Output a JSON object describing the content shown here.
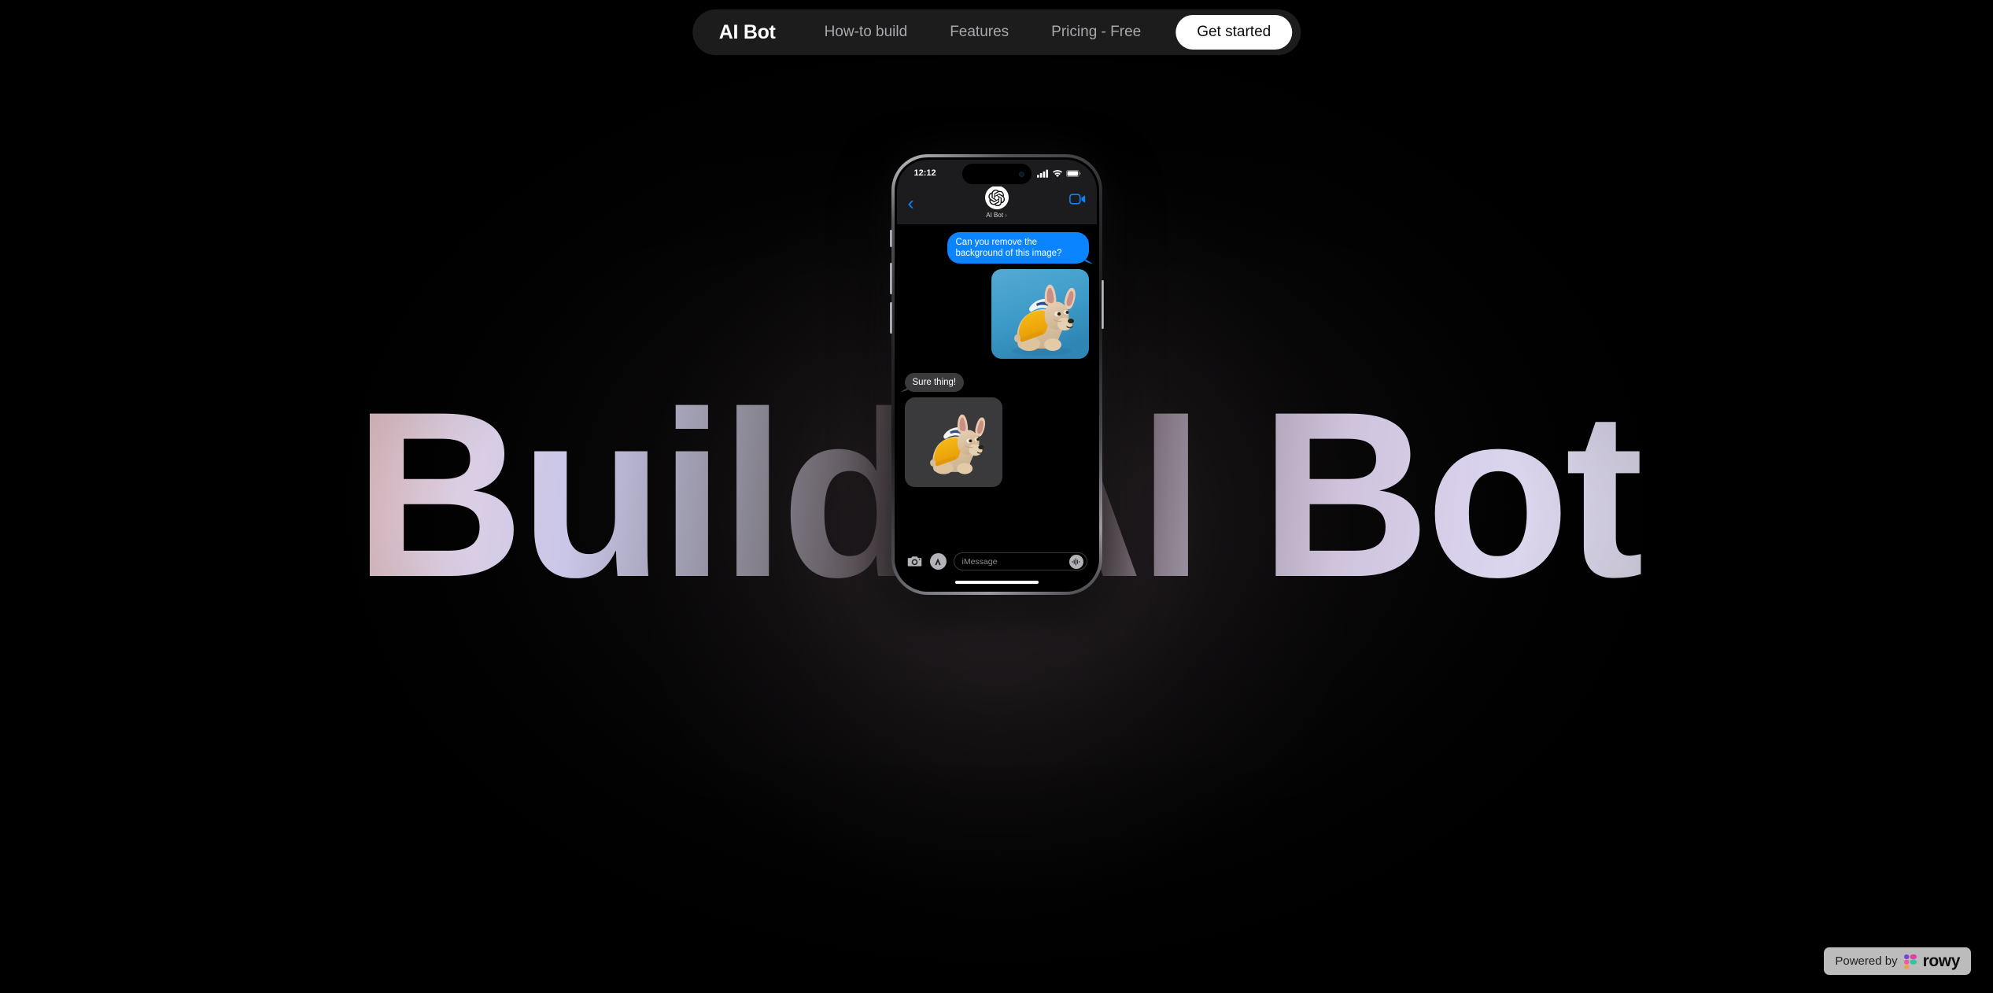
{
  "nav": {
    "brand": "AI Bot",
    "links": [
      {
        "label": "How-to build"
      },
      {
        "label": "Features"
      },
      {
        "label": "Pricing - Free"
      }
    ],
    "cta_label": "Get started"
  },
  "hero": {
    "headline": "Build AI Bot",
    "gradient_start": "#f6c4b7",
    "gradient_mid": "#c9c6e8",
    "gradient_end": "#eceaf6",
    "background_color": "#000000"
  },
  "phone": {
    "status_bar": {
      "time": "12:12",
      "cellular_icon": "cellular-bars-icon",
      "wifi_icon": "wifi-icon",
      "battery_icon": "battery-icon"
    },
    "chat_header": {
      "back_icon": "chevron-left-icon",
      "avatar_icon": "openai-logo-icon",
      "contact_name": "AI Bot",
      "disclosure_chevron": "›",
      "video_icon": "video-camera-icon"
    },
    "messages": [
      {
        "side": "outgoing",
        "type": "text",
        "text": "Can you remove the background of this image?",
        "bubble_color": "#0b84ff"
      },
      {
        "side": "outgoing",
        "type": "image",
        "alt": "French bulldog in yellow hoodie on blue background",
        "background_color": "#3d9bc9"
      },
      {
        "side": "incoming",
        "type": "text",
        "text": "Sure thing!",
        "bubble_color": "#3a3a3c"
      },
      {
        "side": "incoming",
        "type": "image",
        "alt": "French bulldog in yellow hoodie with background removed",
        "background_color": "#3a3a3c"
      }
    ],
    "input_bar": {
      "camera_icon": "camera-icon",
      "apps_icon": "app-store-icon",
      "placeholder": "iMessage",
      "audio_icon": "audio-waveform-icon"
    }
  },
  "footer_badge": {
    "prefix": "Powered by",
    "brand": "rowy",
    "logo_icon": "rowy-logo-icon",
    "background_color": "#bcbcbc"
  }
}
